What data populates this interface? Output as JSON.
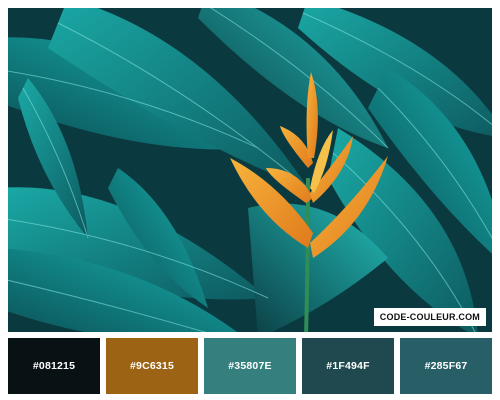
{
  "photo": {
    "description_icon": "tropical-leaves-image",
    "watermark": "CODE-COULEUR.COM"
  },
  "palette": [
    {
      "hex": "#081215",
      "label": "#081215"
    },
    {
      "hex": "#9C6315",
      "label": "#9C6315"
    },
    {
      "hex": "#35807E",
      "label": "#35807E"
    },
    {
      "hex": "#1F494F",
      "label": "#1F494F"
    },
    {
      "hex": "#285F67",
      "label": "#285F67"
    }
  ]
}
